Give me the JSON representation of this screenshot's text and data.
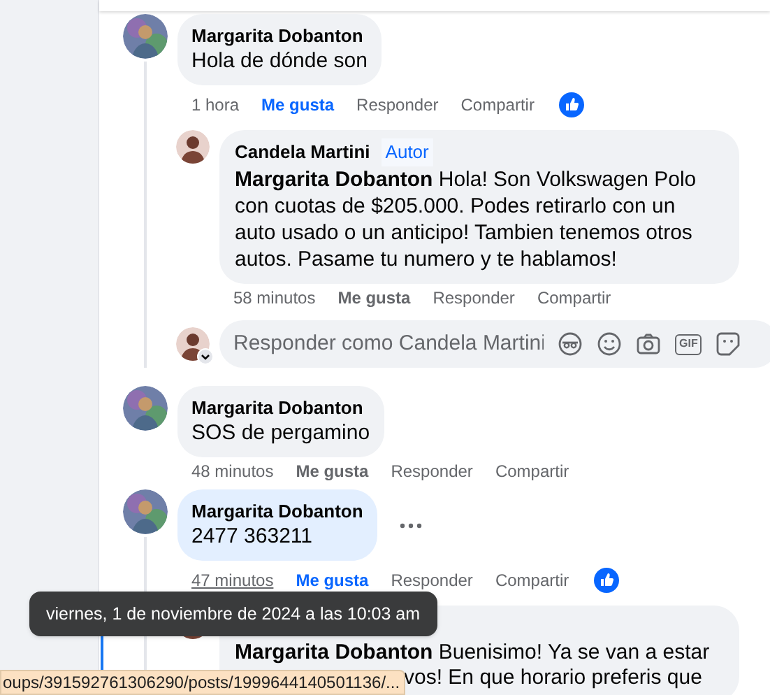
{
  "comments": [
    {
      "author": "Margarita Dobanton",
      "text": "Hola de dónde son",
      "time": "1 hora",
      "hovered": false,
      "highlighted": false,
      "more": false,
      "liked": true,
      "reacted": true,
      "like": "Me gusta",
      "reply": "Responder",
      "share": "Compartir",
      "replies": [
        {
          "author": "Candela Martini",
          "badge": "Autor",
          "mention": "Margarita Dobanton",
          "text": "Hola! Son Volkswagen Polo con cuotas de $205.000. Podes retirarlo con un auto usado o un anticipo! Tambien tenemos otros autos. Pasame tu numero y te hablamos!",
          "time": "58 minutos",
          "liked": false,
          "like": "Me gusta",
          "reply": "Responder",
          "share": "Compartir"
        }
      ],
      "reply_box": {
        "placeholder": "Responder como Candela Martini",
        "gif": "GIF"
      }
    },
    {
      "author": "Margarita Dobanton",
      "text": "SOS de pergamino",
      "time": "48 minutos",
      "hovered": false,
      "highlighted": false,
      "more": false,
      "liked": false,
      "reacted": false,
      "like": "Me gusta",
      "reply": "Responder",
      "share": "Compartir"
    },
    {
      "author": "Margarita Dobanton",
      "text": "2477 363211",
      "time": "47 minutos",
      "hovered": true,
      "highlighted": true,
      "more": true,
      "liked": true,
      "reacted": true,
      "like": "Me gusta",
      "reply": "Responder",
      "share": "Compartir",
      "replies": [
        {
          "mention": "Margarita Dobanton",
          "text": "Buenisimo! Ya se van a estar",
          "text_tail": "vos! En que horario preferis que"
        }
      ]
    }
  ],
  "tooltip": "viernes, 1 de noviembre de 2024 a las 10:03 am",
  "status_url": "oups/391592761306290/posts/1999644140501136/..."
}
